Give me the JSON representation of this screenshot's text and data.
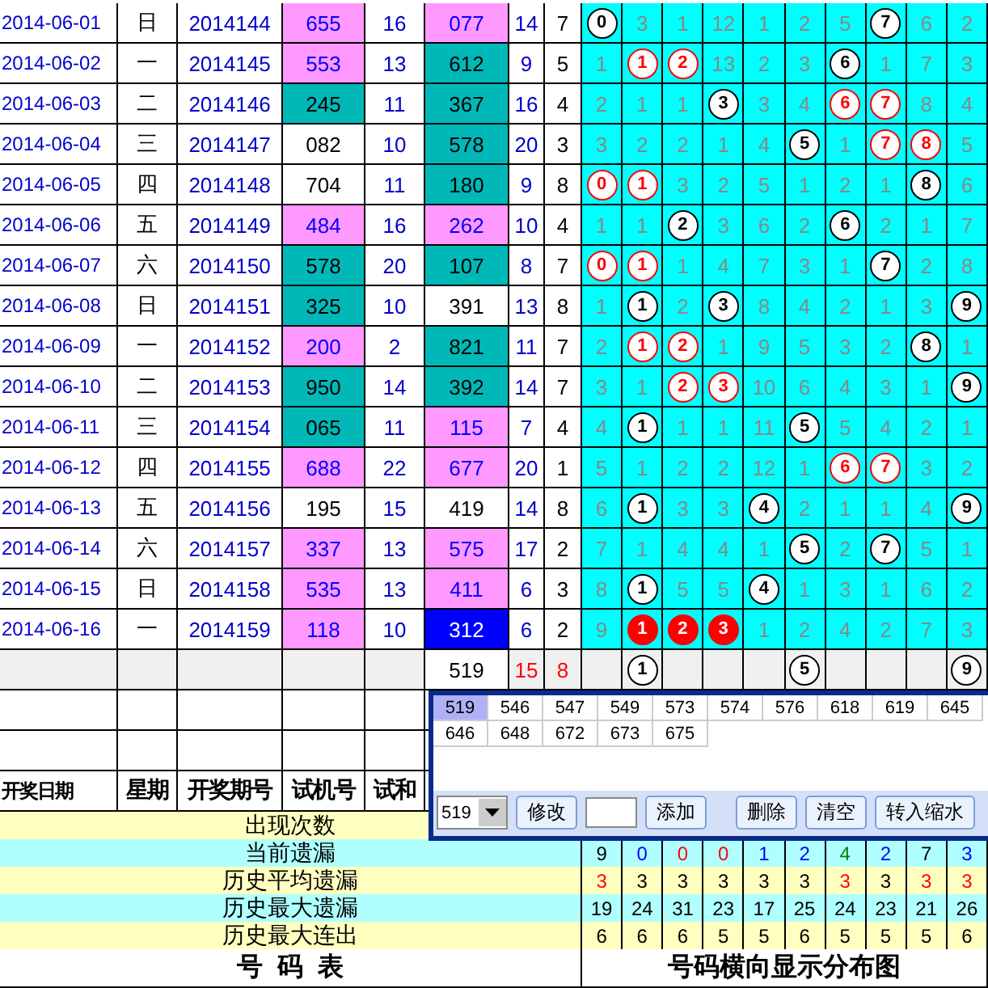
{
  "rows": [
    {
      "date": "2014-06-01",
      "weekday": "日",
      "period": "2014144",
      "trial": {
        "value": "655",
        "color": "#ff99ff"
      },
      "trial_sum": "16",
      "draw": {
        "value": "077",
        "color": "#ff99ff"
      },
      "sum": "14",
      "span": "7",
      "dist": [
        {
          "kind": "ball",
          "text": "0"
        },
        {
          "kind": "miss",
          "text": "3"
        },
        {
          "kind": "miss",
          "text": "1"
        },
        {
          "kind": "miss",
          "text": "12"
        },
        {
          "kind": "miss",
          "text": "1"
        },
        {
          "kind": "miss",
          "text": "2"
        },
        {
          "kind": "miss",
          "text": "5"
        },
        {
          "kind": "ball",
          "text": "7"
        },
        {
          "kind": "miss",
          "text": "6"
        },
        {
          "kind": "miss",
          "text": "2"
        }
      ]
    },
    {
      "date": "2014-06-02",
      "weekday": "一",
      "period": "2014145",
      "trial": {
        "value": "553",
        "color": "#ff99ff"
      },
      "trial_sum": "13",
      "draw": {
        "value": "612",
        "color": "#00b8b8"
      },
      "sum": "9",
      "span": "5",
      "dist": [
        {
          "kind": "miss",
          "text": "1"
        },
        {
          "kind": "red",
          "text": "1"
        },
        {
          "kind": "red",
          "text": "2"
        },
        {
          "kind": "miss",
          "text": "13"
        },
        {
          "kind": "miss",
          "text": "2"
        },
        {
          "kind": "miss",
          "text": "3"
        },
        {
          "kind": "ball",
          "text": "6"
        },
        {
          "kind": "miss",
          "text": "1"
        },
        {
          "kind": "miss",
          "text": "7"
        },
        {
          "kind": "miss",
          "text": "3"
        }
      ]
    },
    {
      "date": "2014-06-03",
      "weekday": "二",
      "period": "2014146",
      "trial": {
        "value": "245",
        "color": "#00b8b8"
      },
      "trial_sum": "11",
      "draw": {
        "value": "367",
        "color": "#00b8b8"
      },
      "sum": "16",
      "span": "4",
      "dist": [
        {
          "kind": "miss",
          "text": "2"
        },
        {
          "kind": "miss",
          "text": "1"
        },
        {
          "kind": "miss",
          "text": "1"
        },
        {
          "kind": "ball",
          "text": "3"
        },
        {
          "kind": "miss",
          "text": "3"
        },
        {
          "kind": "miss",
          "text": "4"
        },
        {
          "kind": "red",
          "text": "6"
        },
        {
          "kind": "red",
          "text": "7"
        },
        {
          "kind": "miss",
          "text": "8"
        },
        {
          "kind": "miss",
          "text": "4"
        }
      ]
    },
    {
      "date": "2014-06-04",
      "weekday": "三",
      "period": "2014147",
      "trial": {
        "value": "082"
      },
      "trial_sum": "10",
      "draw": {
        "value": "578",
        "color": "#00b8b8"
      },
      "sum": "20",
      "span": "3",
      "dist": [
        {
          "kind": "miss",
          "text": "3"
        },
        {
          "kind": "miss",
          "text": "2"
        },
        {
          "kind": "miss",
          "text": "2"
        },
        {
          "kind": "miss",
          "text": "1"
        },
        {
          "kind": "miss",
          "text": "4"
        },
        {
          "kind": "ball",
          "text": "5"
        },
        {
          "kind": "miss",
          "text": "1"
        },
        {
          "kind": "red",
          "text": "7"
        },
        {
          "kind": "red",
          "text": "8"
        },
        {
          "kind": "miss",
          "text": "5"
        }
      ]
    },
    {
      "date": "2014-06-05",
      "weekday": "四",
      "period": "2014148",
      "trial": {
        "value": "704"
      },
      "trial_sum": "11",
      "draw": {
        "value": "180",
        "color": "#00b8b8"
      },
      "sum": "9",
      "span": "8",
      "dist": [
        {
          "kind": "red",
          "text": "0"
        },
        {
          "kind": "red",
          "text": "1"
        },
        {
          "kind": "miss",
          "text": "3"
        },
        {
          "kind": "miss",
          "text": "2"
        },
        {
          "kind": "miss",
          "text": "5"
        },
        {
          "kind": "miss",
          "text": "1"
        },
        {
          "kind": "miss",
          "text": "2"
        },
        {
          "kind": "miss",
          "text": "1"
        },
        {
          "kind": "ball",
          "text": "8"
        },
        {
          "kind": "miss",
          "text": "6"
        }
      ]
    },
    {
      "date": "2014-06-06",
      "weekday": "五",
      "period": "2014149",
      "trial": {
        "value": "484",
        "color": "#ff99ff"
      },
      "trial_sum": "16",
      "draw": {
        "value": "262",
        "color": "#ff99ff"
      },
      "sum": "10",
      "span": "4",
      "dist": [
        {
          "kind": "miss",
          "text": "1"
        },
        {
          "kind": "miss",
          "text": "1"
        },
        {
          "kind": "ball",
          "text": "2"
        },
        {
          "kind": "miss",
          "text": "3"
        },
        {
          "kind": "miss",
          "text": "6"
        },
        {
          "kind": "miss",
          "text": "2"
        },
        {
          "kind": "ball",
          "text": "6"
        },
        {
          "kind": "miss",
          "text": "2"
        },
        {
          "kind": "miss",
          "text": "1"
        },
        {
          "kind": "miss",
          "text": "7"
        }
      ]
    },
    {
      "date": "2014-06-07",
      "weekday": "六",
      "period": "2014150",
      "trial": {
        "value": "578",
        "color": "#00b8b8"
      },
      "trial_sum": "20",
      "draw": {
        "value": "107",
        "color": "#00b8b8"
      },
      "sum": "8",
      "span": "7",
      "dist": [
        {
          "kind": "red",
          "text": "0"
        },
        {
          "kind": "red",
          "text": "1"
        },
        {
          "kind": "miss",
          "text": "1"
        },
        {
          "kind": "miss",
          "text": "4"
        },
        {
          "kind": "miss",
          "text": "7"
        },
        {
          "kind": "miss",
          "text": "3"
        },
        {
          "kind": "miss",
          "text": "1"
        },
        {
          "kind": "ball",
          "text": "7"
        },
        {
          "kind": "miss",
          "text": "2"
        },
        {
          "kind": "miss",
          "text": "8"
        }
      ]
    },
    {
      "date": "2014-06-08",
      "weekday": "日",
      "period": "2014151",
      "trial": {
        "value": "325",
        "color": "#00b8b8"
      },
      "trial_sum": "10",
      "draw": {
        "value": "391"
      },
      "sum": "13",
      "span": "8",
      "dist": [
        {
          "kind": "miss",
          "text": "1"
        },
        {
          "kind": "ball",
          "text": "1"
        },
        {
          "kind": "miss",
          "text": "2"
        },
        {
          "kind": "ball",
          "text": "3"
        },
        {
          "kind": "miss",
          "text": "8"
        },
        {
          "kind": "miss",
          "text": "4"
        },
        {
          "kind": "miss",
          "text": "2"
        },
        {
          "kind": "miss",
          "text": "1"
        },
        {
          "kind": "miss",
          "text": "3"
        },
        {
          "kind": "ball",
          "text": "9"
        }
      ]
    },
    {
      "date": "2014-06-09",
      "weekday": "一",
      "period": "2014152",
      "trial": {
        "value": "200",
        "color": "#ff99ff"
      },
      "trial_sum": "2",
      "draw": {
        "value": "821",
        "color": "#00b8b8"
      },
      "sum": "11",
      "span": "7",
      "dist": [
        {
          "kind": "miss",
          "text": "2"
        },
        {
          "kind": "red",
          "text": "1"
        },
        {
          "kind": "red",
          "text": "2"
        },
        {
          "kind": "miss",
          "text": "1"
        },
        {
          "kind": "miss",
          "text": "9"
        },
        {
          "kind": "miss",
          "text": "5"
        },
        {
          "kind": "miss",
          "text": "3"
        },
        {
          "kind": "miss",
          "text": "2"
        },
        {
          "kind": "ball",
          "text": "8"
        },
        {
          "kind": "miss",
          "text": "1"
        }
      ]
    },
    {
      "date": "2014-06-10",
      "weekday": "二",
      "period": "2014153",
      "trial": {
        "value": "950",
        "color": "#00b8b8"
      },
      "trial_sum": "14",
      "draw": {
        "value": "392",
        "color": "#00b8b8"
      },
      "sum": "14",
      "span": "7",
      "dist": [
        {
          "kind": "miss",
          "text": "3"
        },
        {
          "kind": "miss",
          "text": "1"
        },
        {
          "kind": "red",
          "text": "2"
        },
        {
          "kind": "red",
          "text": "3"
        },
        {
          "kind": "miss",
          "text": "10"
        },
        {
          "kind": "miss",
          "text": "6"
        },
        {
          "kind": "miss",
          "text": "4"
        },
        {
          "kind": "miss",
          "text": "3"
        },
        {
          "kind": "miss",
          "text": "1"
        },
        {
          "kind": "ball",
          "text": "9"
        }
      ]
    },
    {
      "date": "2014-06-11",
      "weekday": "三",
      "period": "2014154",
      "trial": {
        "value": "065",
        "color": "#00b8b8"
      },
      "trial_sum": "11",
      "draw": {
        "value": "115",
        "color": "#ff99ff"
      },
      "sum": "7",
      "span": "4",
      "dist": [
        {
          "kind": "miss",
          "text": "4"
        },
        {
          "kind": "ball",
          "text": "1"
        },
        {
          "kind": "miss",
          "text": "1"
        },
        {
          "kind": "miss",
          "text": "1"
        },
        {
          "kind": "miss",
          "text": "11"
        },
        {
          "kind": "ball",
          "text": "5"
        },
        {
          "kind": "miss",
          "text": "5"
        },
        {
          "kind": "miss",
          "text": "4"
        },
        {
          "kind": "miss",
          "text": "2"
        },
        {
          "kind": "miss",
          "text": "1"
        }
      ]
    },
    {
      "date": "2014-06-12",
      "weekday": "四",
      "period": "2014155",
      "trial": {
        "value": "688",
        "color": "#ff99ff"
      },
      "trial_sum": "22",
      "draw": {
        "value": "677",
        "color": "#ff99ff"
      },
      "sum": "20",
      "span": "1",
      "dist": [
        {
          "kind": "miss",
          "text": "5"
        },
        {
          "kind": "miss",
          "text": "1"
        },
        {
          "kind": "miss",
          "text": "2"
        },
        {
          "kind": "miss",
          "text": "2"
        },
        {
          "kind": "miss",
          "text": "12"
        },
        {
          "kind": "miss",
          "text": "1"
        },
        {
          "kind": "red",
          "text": "6"
        },
        {
          "kind": "red",
          "text": "7"
        },
        {
          "kind": "miss",
          "text": "3"
        },
        {
          "kind": "miss",
          "text": "2"
        }
      ]
    },
    {
      "date": "2014-06-13",
      "weekday": "五",
      "period": "2014156",
      "trial": {
        "value": "195"
      },
      "trial_sum": "15",
      "draw": {
        "value": "419"
      },
      "sum": "14",
      "span": "8",
      "dist": [
        {
          "kind": "miss",
          "text": "6"
        },
        {
          "kind": "ball",
          "text": "1"
        },
        {
          "kind": "miss",
          "text": "3"
        },
        {
          "kind": "miss",
          "text": "3"
        },
        {
          "kind": "ball",
          "text": "4"
        },
        {
          "kind": "miss",
          "text": "2"
        },
        {
          "kind": "miss",
          "text": "1"
        },
        {
          "kind": "miss",
          "text": "1"
        },
        {
          "kind": "miss",
          "text": "4"
        },
        {
          "kind": "ball",
          "text": "9"
        }
      ]
    },
    {
      "date": "2014-06-14",
      "weekday": "六",
      "period": "2014157",
      "trial": {
        "value": "337",
        "color": "#ff99ff"
      },
      "trial_sum": "13",
      "draw": {
        "value": "575",
        "color": "#ff99ff"
      },
      "sum": "17",
      "span": "2",
      "dist": [
        {
          "kind": "miss",
          "text": "7"
        },
        {
          "kind": "miss",
          "text": "1"
        },
        {
          "kind": "miss",
          "text": "4"
        },
        {
          "kind": "miss",
          "text": "4"
        },
        {
          "kind": "miss",
          "text": "1"
        },
        {
          "kind": "ball",
          "text": "5"
        },
        {
          "kind": "miss",
          "text": "2"
        },
        {
          "kind": "ball",
          "text": "7"
        },
        {
          "kind": "miss",
          "text": "5"
        },
        {
          "kind": "miss",
          "text": "1"
        }
      ]
    },
    {
      "date": "2014-06-15",
      "weekday": "日",
      "period": "2014158",
      "trial": {
        "value": "535",
        "color": "#ff99ff"
      },
      "trial_sum": "13",
      "draw": {
        "value": "411",
        "color": "#ff99ff"
      },
      "sum": "6",
      "span": "3",
      "dist": [
        {
          "kind": "miss",
          "text": "8"
        },
        {
          "kind": "ball",
          "text": "1"
        },
        {
          "kind": "miss",
          "text": "5"
        },
        {
          "kind": "miss",
          "text": "5"
        },
        {
          "kind": "ball",
          "text": "4"
        },
        {
          "kind": "miss",
          "text": "1"
        },
        {
          "kind": "miss",
          "text": "3"
        },
        {
          "kind": "miss",
          "text": "1"
        },
        {
          "kind": "miss",
          "text": "6"
        },
        {
          "kind": "miss",
          "text": "2"
        }
      ]
    },
    {
      "date": "2014-06-16",
      "weekday": "一",
      "period": "2014159",
      "trial": {
        "value": "118",
        "color": "#ff99ff"
      },
      "trial_sum": "10",
      "draw": {
        "value": "312",
        "color": "#0000ff"
      },
      "sum": "6",
      "span": "2",
      "dist": [
        {
          "kind": "miss",
          "text": "9"
        },
        {
          "kind": "solid",
          "text": "1"
        },
        {
          "kind": "solid",
          "text": "2"
        },
        {
          "kind": "solid",
          "text": "3"
        },
        {
          "kind": "miss",
          "text": "1"
        },
        {
          "kind": "miss",
          "text": "2"
        },
        {
          "kind": "miss",
          "text": "4"
        },
        {
          "kind": "miss",
          "text": "2"
        },
        {
          "kind": "miss",
          "text": "7"
        },
        {
          "kind": "miss",
          "text": "3"
        }
      ]
    }
  ],
  "summary": {
    "draw": "519",
    "sum": "15",
    "span": "8",
    "dist": [
      {
        "kind": "blank"
      },
      {
        "kind": "ball",
        "text": "1"
      },
      {
        "kind": "blank"
      },
      {
        "kind": "blank"
      },
      {
        "kind": "blank"
      },
      {
        "kind": "ball",
        "text": "5"
      },
      {
        "kind": "blank"
      },
      {
        "kind": "blank"
      },
      {
        "kind": "blank"
      },
      {
        "kind": "ball",
        "text": "9"
      }
    ]
  },
  "headers": [
    "开奖日期",
    "星期",
    "开奖期号",
    "试机号",
    "试和"
  ],
  "stats": [
    {
      "label": "出现次数"
    },
    {
      "label": "当前遗漏",
      "values": [
        {
          "text": "9",
          "color": "#000000"
        },
        {
          "text": "0",
          "color": "#0000ff"
        },
        {
          "text": "0",
          "color": "#ff0000"
        },
        {
          "text": "0",
          "color": "#ff0000"
        },
        {
          "text": "1",
          "color": "#0000ff"
        },
        {
          "text": "2",
          "color": "#0000ff"
        },
        {
          "text": "4",
          "color": "#008000"
        },
        {
          "text": "2",
          "color": "#0000ff"
        },
        {
          "text": "7",
          "color": "#000000"
        },
        {
          "text": "3",
          "color": "#0000ff"
        }
      ]
    },
    {
      "label": "历史平均遗漏",
      "values": [
        {
          "text": "3",
          "color": "#ff0000"
        },
        {
          "text": "3",
          "color": "#000000"
        },
        {
          "text": "3",
          "color": "#000000"
        },
        {
          "text": "3",
          "color": "#000000"
        },
        {
          "text": "3",
          "color": "#000000"
        },
        {
          "text": "3",
          "color": "#000000"
        },
        {
          "text": "3",
          "color": "#ff0000"
        },
        {
          "text": "3",
          "color": "#000000"
        },
        {
          "text": "3",
          "color": "#ff0000"
        },
        {
          "text": "3",
          "color": "#ff0000"
        }
      ]
    },
    {
      "label": "历史最大遗漏",
      "values": [
        {
          "text": "19"
        },
        {
          "text": "24"
        },
        {
          "text": "31"
        },
        {
          "text": "23"
        },
        {
          "text": "17"
        },
        {
          "text": "25"
        },
        {
          "text": "24"
        },
        {
          "text": "23"
        },
        {
          "text": "21"
        },
        {
          "text": "26"
        }
      ]
    },
    {
      "label": "历史最大连出",
      "values": [
        {
          "text": "6"
        },
        {
          "text": "6"
        },
        {
          "text": "6"
        },
        {
          "text": "5"
        },
        {
          "text": "5"
        },
        {
          "text": "6"
        },
        {
          "text": "5"
        },
        {
          "text": "5"
        },
        {
          "text": "5"
        },
        {
          "text": "6"
        }
      ]
    }
  ],
  "footer": {
    "left": "号  码  表",
    "right": "号码横向显示分布图"
  },
  "popup": {
    "numbers": [
      {
        "text": "519",
        "selected": true
      },
      {
        "text": "546",
        "selected": false
      },
      {
        "text": "547",
        "selected": false
      },
      {
        "text": "549",
        "selected": false
      },
      {
        "text": "573",
        "selected": false
      },
      {
        "text": "574",
        "selected": false
      },
      {
        "text": "576",
        "selected": false
      },
      {
        "text": "618",
        "selected": false
      },
      {
        "text": "619",
        "selected": false
      },
      {
        "text": "645",
        "selected": false
      },
      {
        "text": "646",
        "selected": false
      },
      {
        "text": "648",
        "selected": false
      },
      {
        "text": "672",
        "selected": false
      },
      {
        "text": "673",
        "selected": false
      },
      {
        "text": "675",
        "selected": false
      }
    ],
    "controls": [
      {
        "kind": "select",
        "value": "519"
      },
      {
        "kind": "button",
        "label": "修改"
      },
      {
        "kind": "input"
      },
      {
        "kind": "button",
        "label": "添加"
      },
      {
        "kind": "gap"
      },
      {
        "kind": "button",
        "label": "删除"
      },
      {
        "kind": "button",
        "label": "清空"
      },
      {
        "kind": "button",
        "label": "转入缩水"
      }
    ]
  }
}
